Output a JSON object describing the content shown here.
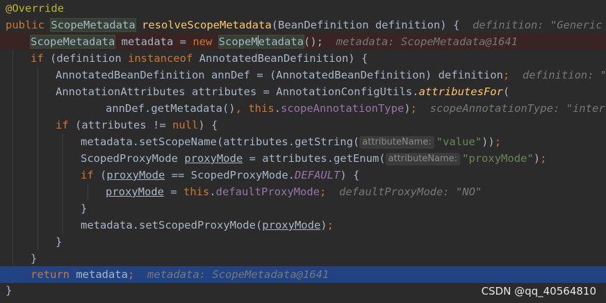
{
  "annotation": "@Override",
  "l1": {
    "kw": "public",
    "type": "ScopeMetadata",
    "method": "resolveScopeMetadata",
    "params": "(BeanDefinition definition) {",
    "hint": "definition: \"Generic bea"
  },
  "l2": {
    "type": "ScopeMetadata",
    "mid": " metadata = ",
    "kw": "new",
    "ctor_a": "ScopeM",
    "ctor_b": "etadata",
    "end": "();",
    "hint": "metadata: ScopeMetadata@1641"
  },
  "l3": {
    "kw1": "if",
    "a": " (definition ",
    "kw2": "instanceof",
    "b": " AnnotatedBeanDefinition) {"
  },
  "l4": {
    "code": "AnnotatedBeanDefinition annDef = (AnnotatedBeanDefinition) definition",
    "semi": ";",
    "hint": "definition: \"Gen"
  },
  "l5": {
    "a": "AnnotationAttributes attributes = AnnotationConfigUtils.",
    "method": "attributesFor",
    "b": "("
  },
  "l6": {
    "a": "annDef.getMetadata()",
    "comma": ",",
    "kw": "this",
    "dot": ".",
    "field": "scopeAnnotationType",
    "end": ")",
    "semi": ";",
    "hint": "scopeAnnotationType: \"interfac"
  },
  "l7": {
    "kw1": "if",
    "a": " (attributes != ",
    "kw2": "null",
    "b": ") {"
  },
  "l8": {
    "a": "metadata.setScopeName(attributes.getString(",
    "inlay": "attributeName:",
    "str": "\"value\"",
    "end": "))",
    "semi": ";"
  },
  "l9": {
    "a": "ScopedProxyMode ",
    "var": "proxyMode",
    "b": " = attributes.getEnum(",
    "inlay": "attributeName:",
    "str": "\"proxyMode\"",
    "end": ")",
    "semi": ";"
  },
  "l10": {
    "kw": "if",
    "a": " (",
    "var": "proxyMode",
    "b": " == ScopedProxyMode.",
    "const": "DEFAULT",
    "c": ") {"
  },
  "l11": {
    "var": "proxyMode",
    "a": " = ",
    "kw": "this",
    "dot": ".",
    "field": "defaultProxyMode",
    "semi": ";",
    "hint": "defaultProxyMode: \"NO\""
  },
  "l12": {
    "text": "}"
  },
  "l13": {
    "a": "metadata.setScopedProxyMode(",
    "var": "proxyMode",
    "b": ")",
    "semi": ";"
  },
  "l14": {
    "text": "}"
  },
  "l15": {
    "text": "}"
  },
  "l16": {
    "kw": "return",
    "a": " metadata",
    "semi": ";",
    "hint": "metadata: ScopeMetadata@1641"
  },
  "l17": {
    "text": "}"
  },
  "watermark": "CSDN @qq_40564810",
  "colors": {
    "background": "#2b2b2b",
    "keyword": "#cc7832",
    "method": "#ffc66d",
    "string": "#6a8759",
    "field": "#9876aa",
    "annotation": "#bbb529",
    "current_line": "#214283"
  }
}
